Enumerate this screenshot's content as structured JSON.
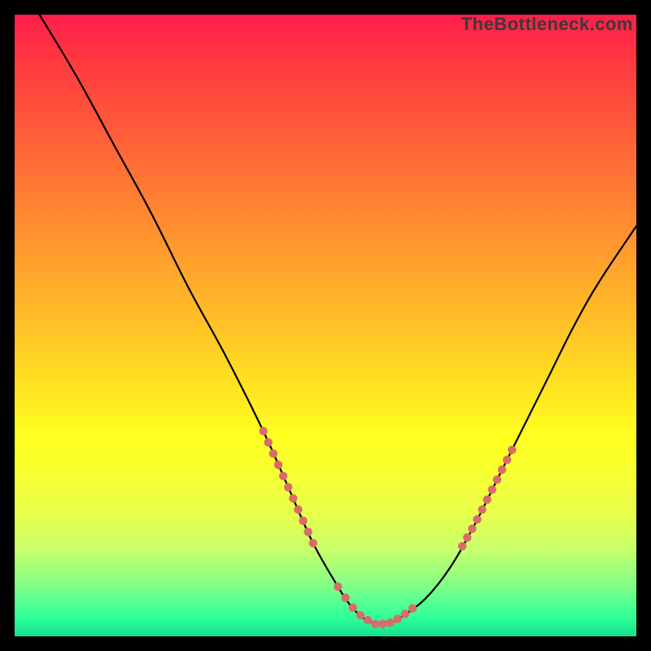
{
  "watermark": "TheBottleneck.com",
  "chart_data": {
    "type": "line",
    "title": "",
    "xlabel": "",
    "ylabel": "",
    "xlim": [
      0,
      100
    ],
    "ylim": [
      0,
      100
    ],
    "grid": false,
    "legend": false,
    "background_gradient": {
      "top": "#ff1e4a",
      "mid": "#ffff1f",
      "bottom": "#14e08a"
    },
    "series": [
      {
        "name": "bottleneck-curve",
        "color": "#000000",
        "x": [
          4,
          10,
          16,
          22,
          28,
          34,
          40,
          44,
          48,
          52,
          54,
          56,
          58,
          60,
          62,
          66,
          70,
          74,
          78,
          82,
          86,
          90,
          94,
          100
        ],
        "y": [
          100,
          90,
          79,
          68,
          56,
          45,
          33,
          24,
          15,
          8,
          5,
          3,
          2,
          2,
          3,
          6,
          11,
          18,
          26,
          34,
          42,
          50,
          57,
          66
        ]
      },
      {
        "name": "highlight-left-slope",
        "color": "#e06666",
        "style": "dotted",
        "x": [
          40,
          42,
          44,
          46,
          48
        ],
        "y": [
          33,
          28,
          24,
          19,
          15
        ]
      },
      {
        "name": "highlight-valley-floor",
        "color": "#e06666",
        "style": "dotted",
        "x": [
          52,
          54,
          56,
          58,
          60,
          62,
          64
        ],
        "y": [
          8,
          5,
          3,
          2,
          2,
          3,
          4
        ]
      },
      {
        "name": "highlight-right-slope",
        "color": "#e06666",
        "style": "dotted",
        "x": [
          72,
          74,
          76,
          78,
          80
        ],
        "y": [
          14,
          18,
          22,
          26,
          30
        ]
      }
    ],
    "annotations": []
  }
}
